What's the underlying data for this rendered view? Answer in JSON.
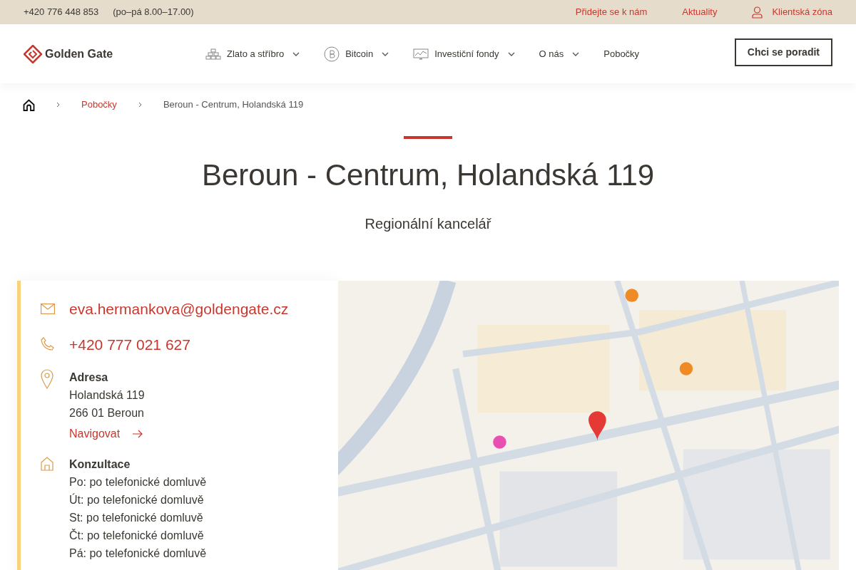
{
  "topbar": {
    "phone": "+420 776 448 853",
    "hours": "(po–pá 8.00–17.00)",
    "links": [
      "Přidejte se k nám",
      "Aktuality"
    ],
    "client_zone": "Klientská zóna"
  },
  "header": {
    "logo": "Golden Gate",
    "nav": [
      {
        "label": "Zlato a stříbro",
        "kind": "bars",
        "dropdown": true
      },
      {
        "label": "Bitcoin",
        "kind": "bitcoin",
        "dropdown": true
      },
      {
        "label": "Investiční fondy",
        "kind": "chart",
        "dropdown": true
      },
      {
        "label": "O nás",
        "kind": "plain",
        "dropdown": true
      },
      {
        "label": "Pobočky",
        "kind": "plain",
        "dropdown": false
      }
    ],
    "cta": "Chci se poradit"
  },
  "breadcrumb": [
    "Pobočky",
    "Beroun - Centrum, Holandská 119"
  ],
  "title": "Beroun - Centrum, Holandská 119",
  "subtitle": "Regionální kancelář",
  "contact": {
    "email": "eva.hermankova@goldengate.cz",
    "phone": "+420 777 021 627",
    "address": {
      "heading": "Adresa",
      "lines": [
        "Holandská 119",
        "266 01 Beroun"
      ],
      "navigate": "Navigovat"
    },
    "hours": {
      "heading": "Konzultace",
      "lines": [
        "Po: po telefonické domluvě",
        "Út: po telefonické domluvě",
        "St: po telefonické domluvě",
        "Čt: po telefonické domluvě",
        "Pá: po telefonické domluvě"
      ]
    }
  }
}
